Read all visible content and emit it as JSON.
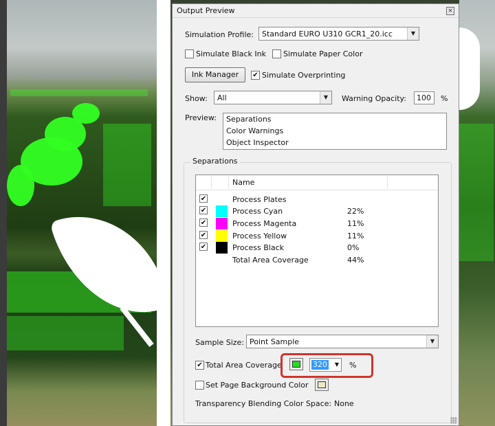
{
  "dialog": {
    "title": "Output Preview",
    "close_glyph": "×",
    "simulation_profile": {
      "label": "Simulation Profile:",
      "value": "Standard EURO U310 GCR1_20.icc"
    },
    "simulate_black_ink": {
      "label": "Simulate Black Ink",
      "checked": false
    },
    "simulate_paper_color": {
      "label": "Simulate Paper Color",
      "checked": false
    },
    "ink_manager_label": "Ink Manager",
    "simulate_overprinting": {
      "label": "Simulate Overprinting",
      "checked": true
    },
    "show": {
      "label": "Show:",
      "value": "All"
    },
    "warning_opacity": {
      "label": "Warning Opacity:",
      "value": "100",
      "unit": "%"
    },
    "preview": {
      "label": "Preview:",
      "items": [
        "Separations",
        "Color Warnings",
        "Object Inspector"
      ],
      "selected": "Separations"
    },
    "separations": {
      "group_label": "Separations",
      "column_name": "Name",
      "rows": [
        {
          "name": "Process Plates",
          "pct": "",
          "checked": true,
          "swatch": ""
        },
        {
          "name": "Process Cyan",
          "pct": "22%",
          "checked": true,
          "swatch": "#00ffff"
        },
        {
          "name": "Process Magenta",
          "pct": "11%",
          "checked": true,
          "swatch": "#ff00ff"
        },
        {
          "name": "Process Yellow",
          "pct": "11%",
          "checked": true,
          "swatch": "#ffff00"
        },
        {
          "name": "Process Black",
          "pct": "0%",
          "checked": true,
          "swatch": "#000000"
        },
        {
          "name": "Total Area Coverage",
          "pct": "44%",
          "checked": false,
          "swatch": ""
        }
      ]
    },
    "sample_size": {
      "label": "Sample Size:",
      "value": "Point Sample"
    },
    "total_area_coverage": {
      "label": "Total Area Coverage",
      "checked": true,
      "color": "#22dd22",
      "value": "320",
      "unit": "%"
    },
    "set_page_background": {
      "label": "Set Page Background Color",
      "checked": false,
      "color": "#ede8c8"
    },
    "transparency_blending": {
      "label": "Transparency Blending Color Space:",
      "value": "None"
    }
  },
  "colors": {
    "highlight": "#d0342c",
    "selection": "#3399ff",
    "warning_green": "#33ff22"
  }
}
